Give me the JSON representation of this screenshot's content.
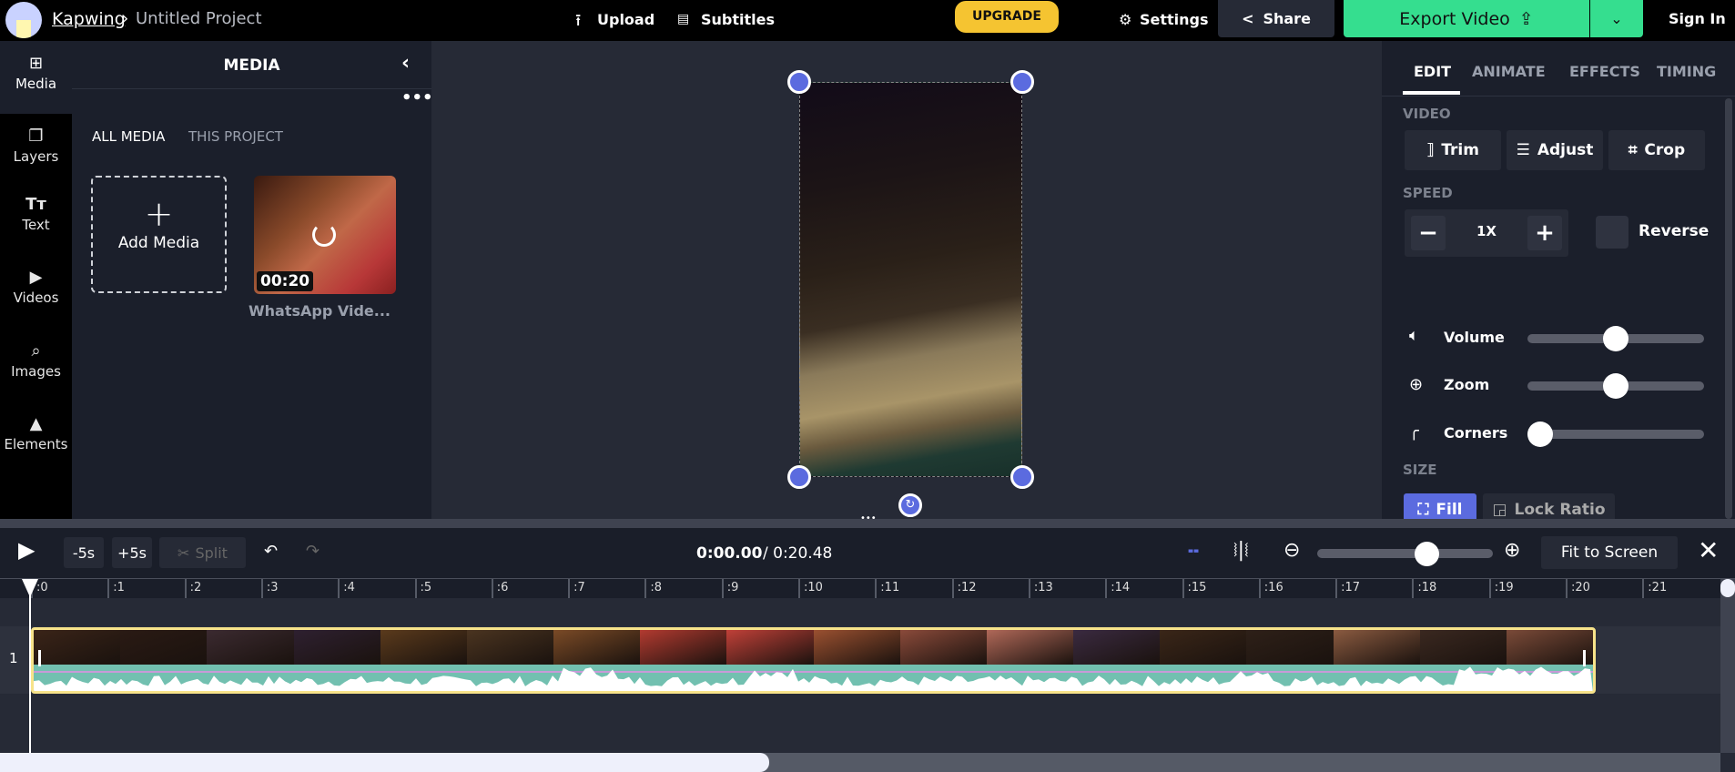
{
  "header": {
    "brand": "Kapwing",
    "breadcrumb_sep": "›",
    "project_title": "Untitled Project",
    "upload": "Upload",
    "subtitles": "Subtitles",
    "upgrade": "UPGRADE",
    "settings": "Settings",
    "share": "Share",
    "export": "Export Video",
    "sign_in": "Sign In"
  },
  "rail": [
    {
      "label": "Media"
    },
    {
      "label": "Layers"
    },
    {
      "label": "Text"
    },
    {
      "label": "Videos"
    },
    {
      "label": "Images"
    },
    {
      "label": "Elements"
    }
  ],
  "media": {
    "title": "MEDIA",
    "tabs": [
      "ALL MEDIA",
      "THIS PROJECT"
    ],
    "add_media": "Add Media",
    "items": [
      {
        "duration": "00:20",
        "name": "WhatsApp Vide..."
      }
    ]
  },
  "right": {
    "tabs": [
      "EDIT",
      "ANIMATE",
      "EFFECTS",
      "TIMING"
    ],
    "video_label": "VIDEO",
    "trim": "Trim",
    "adjust": "Adjust",
    "crop": "Crop",
    "speed_label": "SPEED",
    "speed_value": "1X",
    "reverse": "Reverse",
    "volume": "Volume",
    "zoom": "Zoom",
    "corners": "Corners",
    "volume_pct": 50,
    "zoom_pct": 50,
    "corners_pct": 0,
    "size_label": "SIZE",
    "fill": "Fill",
    "lock_ratio": "Lock Ratio"
  },
  "timeline": {
    "minus5": "-5s",
    "plus5": "+5s",
    "split": "Split",
    "current_time": "0:00.00",
    "total_time": "/ 0:20.48",
    "fit": "Fit to Screen",
    "zoom_pct": 65,
    "track_number": "1",
    "ticks": [
      ":0",
      ":1",
      ":2",
      ":3",
      ":4",
      ":5",
      ":6",
      ":7",
      ":8",
      ":9",
      ":10",
      ":11",
      ":12",
      ":13",
      ":14",
      ":15",
      ":16",
      ":17",
      ":18",
      ":19",
      ":20",
      ":21"
    ]
  },
  "colors": {
    "accent": "#5b6bdf",
    "export": "#35de8f",
    "upgrade": "#f5c431",
    "clip_border": "#f7e38a"
  }
}
